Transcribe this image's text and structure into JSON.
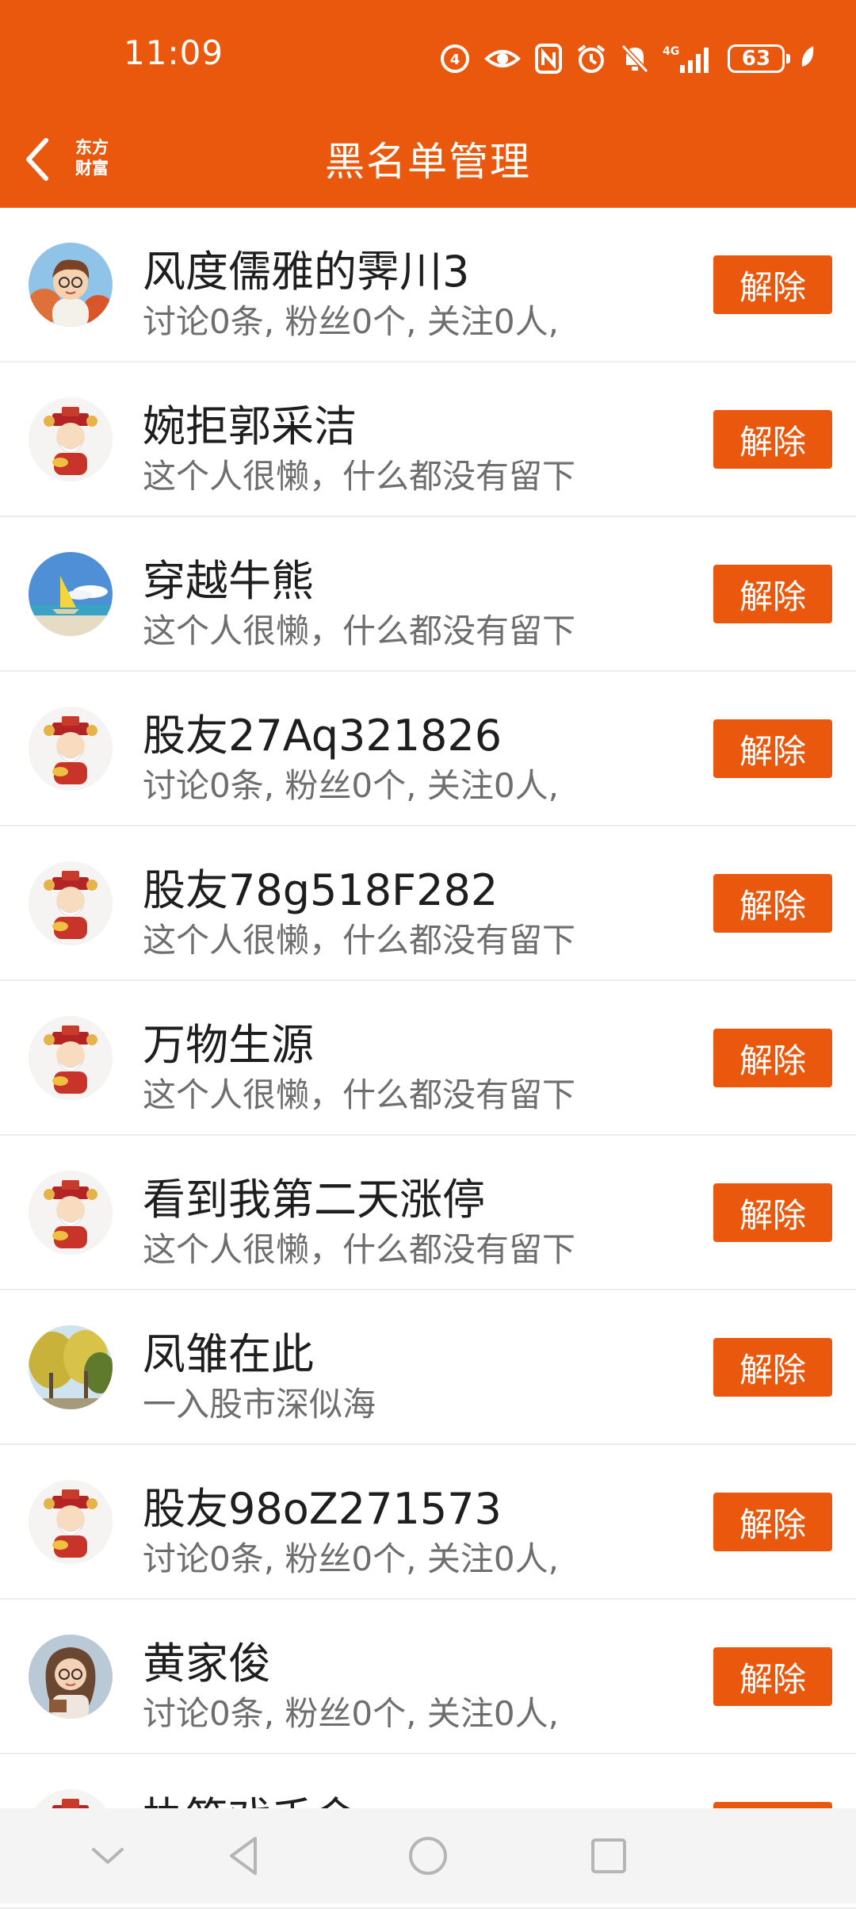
{
  "status_bar": {
    "time": "11:09",
    "battery": "63",
    "network": "4G",
    "icons": [
      "nfc-like-icon",
      "eye-icon",
      "nfc-icon",
      "alarm-icon",
      "mute-bell-icon",
      "signal-icon",
      "battery-icon",
      "leaf-icon"
    ]
  },
  "header": {
    "logo_line1": "东方",
    "logo_line2": "财富",
    "title": "黑名单管理",
    "accent": "#E9580C"
  },
  "list": {
    "items": [
      {
        "name": "风度儒雅的霁川3",
        "desc": "讨论0条, 粉丝0个, 关注0人,",
        "button": "解除",
        "avatar": "cartoon-boy-avatar"
      },
      {
        "name": "婉拒郭采洁",
        "desc": "这个人很懒，什么都没有留下",
        "button": "解除",
        "avatar": "caishen-avatar"
      },
      {
        "name": "穿越牛熊",
        "desc": "这个人很懒，什么都没有留下",
        "button": "解除",
        "avatar": "sailboat-avatar"
      },
      {
        "name": "股友27Aq321826",
        "desc": "讨论0条, 粉丝0个, 关注0人,",
        "button": "解除",
        "avatar": "caishen-avatar"
      },
      {
        "name": "股友78g518F282",
        "desc": "这个人很懒，什么都没有留下",
        "button": "解除",
        "avatar": "caishen-avatar"
      },
      {
        "name": "万物生源",
        "desc": "这个人很懒，什么都没有留下",
        "button": "解除",
        "avatar": "caishen-avatar"
      },
      {
        "name": "看到我第二天涨停",
        "desc": "这个人很懒，什么都没有留下",
        "button": "解除",
        "avatar": "caishen-avatar"
      },
      {
        "name": "凤雏在此",
        "desc": "一入股市深似海",
        "button": "解除",
        "avatar": "trees-avatar"
      },
      {
        "name": "股友98oZ271573",
        "desc": "讨论0条, 粉丝0个, 关注0人,",
        "button": "解除",
        "avatar": "caishen-avatar"
      },
      {
        "name": "黄家俊",
        "desc": "讨论0条, 粉丝0个, 关注0人,",
        "button": "解除",
        "avatar": "cartoon-girl-avatar"
      },
      {
        "name": "执笔戏千金",
        "desc": "",
        "button": "解除",
        "avatar": "caishen-avatar"
      }
    ]
  },
  "system_nav": {
    "icons": [
      "chevron-down-icon",
      "back-triangle-icon",
      "home-circle-icon",
      "recents-square-icon"
    ]
  }
}
